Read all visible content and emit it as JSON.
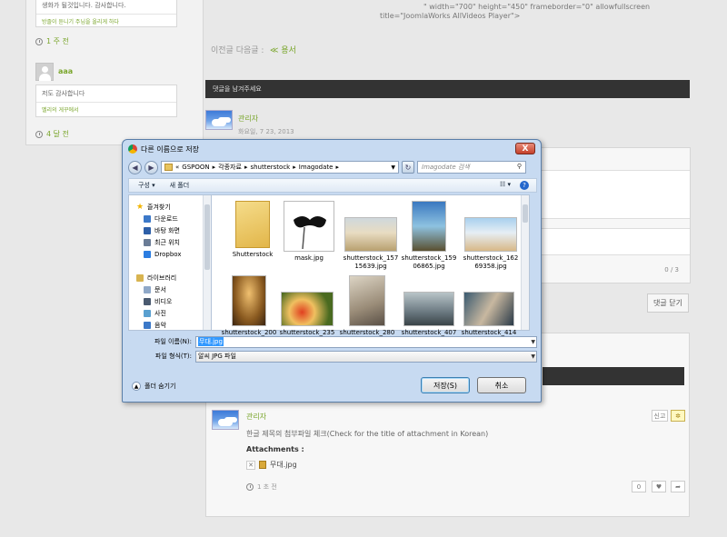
{
  "left": {
    "c1_text": "생화가 될것입니다. 감사합니다.",
    "c1_footer": "방졸이 듣니기 주님을 올리게 하다",
    "c1_time": "1 주 전",
    "c2_user": "aaa",
    "c2_text": "저도 감사합니다",
    "c2_footer": "멜리의 게꾸에서",
    "c2_time": "4 달 전"
  },
  "main": {
    "code_line1": "\" width=\"700\" height=\"450\" frameborder=\"0\" allowfullscreen",
    "code_line2": "title=\"JoomlaWorks AllVideos Player\">",
    "prev_label": "이전글 다음글 :",
    "next_link": "≪ 용서",
    "comment_bar": "댓글을 남겨주세요",
    "admin_name": "관리자",
    "admin_date": "화요일, 7 23, 2013",
    "counter": "0 / 3",
    "close_comment": "댓글 닫기",
    "c_name": "관리자",
    "c_text": "한글 제목의 첨부파일 체크(Check for the title of attachment in Korean)",
    "attach_title": "Attachments :",
    "attach_file": "무대.jpg",
    "c_time": "1 초 전",
    "report_btn": "신고",
    "like_count": "0"
  },
  "dialog": {
    "title": "다른 이름으로 저장",
    "close": "X",
    "path": [
      "«",
      "GSPOON",
      "각종자료",
      "shutterstock",
      "Imagodate"
    ],
    "search_placeholder": "Imagodate 검색",
    "organize": "구성 ▾",
    "new_folder": "새 폴더",
    "nav": [
      {
        "label": "즐겨찾기",
        "icon": "star-icon",
        "head": true
      },
      {
        "label": "다운로드",
        "icon": "download-folder-icon"
      },
      {
        "label": "바탕 화면",
        "icon": "desktop-icon"
      },
      {
        "label": "최근 위치",
        "icon": "recent-places-icon"
      },
      {
        "label": "Dropbox",
        "icon": "dropbox-icon"
      },
      {
        "label": "",
        "icon": ""
      },
      {
        "label": "라이브러리",
        "icon": "library-icon",
        "head": true
      },
      {
        "label": "문서",
        "icon": "documents-icon"
      },
      {
        "label": "비디오",
        "icon": "video-icon"
      },
      {
        "label": "사진",
        "icon": "pictures-icon"
      },
      {
        "label": "음악",
        "icon": "music-icon"
      }
    ],
    "files": [
      {
        "name": "Shutterstock",
        "kind": "folder"
      },
      {
        "name": "mask.jpg",
        "kind": "mask"
      },
      {
        "name": "shutterstock_15715639.jpg",
        "kind": "field"
      },
      {
        "name": "shutterstock_15906865.jpg",
        "kind": "beach1"
      },
      {
        "name": "shutterstock_16269358.jpg",
        "kind": "beach2"
      },
      {
        "name": "shutterstock_200",
        "kind": "church"
      },
      {
        "name": "shutterstock_235",
        "kind": "flowers"
      },
      {
        "name": "shutterstock_280",
        "kind": "stairs"
      },
      {
        "name": "shutterstock_407",
        "kind": "arches"
      },
      {
        "name": "shutterstock_414",
        "kind": "couple"
      }
    ],
    "filename_label": "파일 이름(N):",
    "filename_value": "무대.jpg",
    "filetype_label": "파일 형식(T):",
    "filetype_value": "알씨 JPG 파일",
    "hide_folders": "폴더 숨기기",
    "save": "저장(S)",
    "cancel": "취소"
  }
}
